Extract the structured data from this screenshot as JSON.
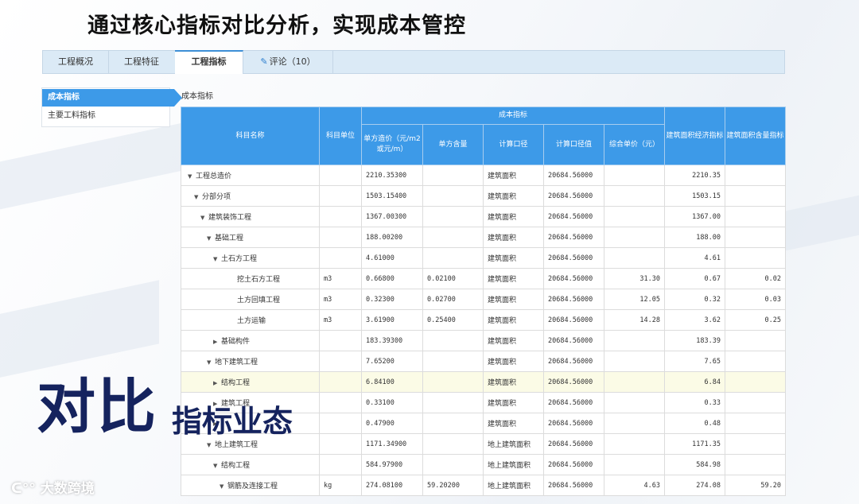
{
  "slide_title": "通过核心指标对比分析，实现成本管控",
  "tabs": [
    {
      "label": "工程概况",
      "active": false
    },
    {
      "label": "工程特征",
      "active": false
    },
    {
      "label": "工程指标",
      "active": true
    },
    {
      "label": "评论（10）",
      "active": false,
      "icon": "pencil-icon"
    }
  ],
  "left_nav": [
    {
      "label": "成本指标",
      "active": true
    },
    {
      "label": "主要工料指标",
      "active": false
    }
  ],
  "section_title": "成本指标",
  "table": {
    "headers": {
      "item_name": "科目名称",
      "unit": "科目单位",
      "group": "成本指标",
      "unit_cost": "单方造价（元/m2或元/m）",
      "unit_qty": "单方含量",
      "calc_basis": "计算口径",
      "calc_value": "计算口径值",
      "comp_price": "综合单价（元）",
      "area_econ": "建筑面积经济指标",
      "area_qty": "建筑面积含量指标"
    },
    "rows": [
      {
        "level": 0,
        "toggle": "expanded",
        "name": "工程总造价",
        "unit": "",
        "unit_cost": "2210.35300",
        "unit_qty": "",
        "basis": "建筑面积",
        "basis_value": "20684.56000",
        "comp_price": "",
        "area_econ": "2210.35",
        "area_qty": "",
        "highlight": false
      },
      {
        "level": 1,
        "toggle": "expanded",
        "name": "分部分项",
        "unit": "",
        "unit_cost": "1503.15400",
        "unit_qty": "",
        "basis": "建筑面积",
        "basis_value": "20684.56000",
        "comp_price": "",
        "area_econ": "1503.15",
        "area_qty": "",
        "highlight": false
      },
      {
        "level": 2,
        "toggle": "expanded",
        "name": "建筑装饰工程",
        "unit": "",
        "unit_cost": "1367.00300",
        "unit_qty": "",
        "basis": "建筑面积",
        "basis_value": "20684.56000",
        "comp_price": "",
        "area_econ": "1367.00",
        "area_qty": "",
        "highlight": false
      },
      {
        "level": 3,
        "toggle": "expanded",
        "name": "基础工程",
        "unit": "",
        "unit_cost": "188.00200",
        "unit_qty": "",
        "basis": "建筑面积",
        "basis_value": "20684.56000",
        "comp_price": "",
        "area_econ": "188.00",
        "area_qty": "",
        "highlight": false
      },
      {
        "level": 4,
        "toggle": "expanded",
        "name": "土石方工程",
        "unit": "",
        "unit_cost": "4.61000",
        "unit_qty": "",
        "basis": "建筑面积",
        "basis_value": "20684.56000",
        "comp_price": "",
        "area_econ": "4.61",
        "area_qty": "",
        "highlight": false
      },
      {
        "level": 5,
        "toggle": "",
        "name": "挖土石方工程",
        "unit": "m3",
        "unit_cost": "0.66800",
        "unit_qty": "0.02100",
        "basis": "建筑面积",
        "basis_value": "20684.56000",
        "comp_price": "31.30",
        "area_econ": "0.67",
        "area_qty": "0.02",
        "highlight": false
      },
      {
        "level": 5,
        "toggle": "",
        "name": "土方回填工程",
        "unit": "m3",
        "unit_cost": "0.32300",
        "unit_qty": "0.02700",
        "basis": "建筑面积",
        "basis_value": "20684.56000",
        "comp_price": "12.05",
        "area_econ": "0.32",
        "area_qty": "0.03",
        "highlight": false
      },
      {
        "level": 5,
        "toggle": "",
        "name": "土方运输",
        "unit": "m3",
        "unit_cost": "3.61900",
        "unit_qty": "0.25400",
        "basis": "建筑面积",
        "basis_value": "20684.56000",
        "comp_price": "14.28",
        "area_econ": "3.62",
        "area_qty": "0.25",
        "highlight": false
      },
      {
        "level": 4,
        "toggle": "collapsed",
        "name": "基础构件",
        "unit": "",
        "unit_cost": "183.39300",
        "unit_qty": "",
        "basis": "建筑面积",
        "basis_value": "20684.56000",
        "comp_price": "",
        "area_econ": "183.39",
        "area_qty": "",
        "highlight": false
      },
      {
        "level": 3,
        "toggle": "expanded",
        "name": "地下建筑工程",
        "unit": "",
        "unit_cost": "7.65200",
        "unit_qty": "",
        "basis": "建筑面积",
        "basis_value": "20684.56000",
        "comp_price": "",
        "area_econ": "7.65",
        "area_qty": "",
        "highlight": false
      },
      {
        "level": 4,
        "toggle": "collapsed",
        "name": "结构工程",
        "unit": "",
        "unit_cost": "6.84100",
        "unit_qty": "",
        "basis": "建筑面积",
        "basis_value": "20684.56000",
        "comp_price": "",
        "area_econ": "6.84",
        "area_qty": "",
        "highlight": true
      },
      {
        "level": 4,
        "toggle": "collapsed",
        "name": "建筑工程",
        "unit": "",
        "unit_cost": "0.33100",
        "unit_qty": "",
        "basis": "建筑面积",
        "basis_value": "20684.56000",
        "comp_price": "",
        "area_econ": "0.33",
        "area_qty": "",
        "highlight": false
      },
      {
        "level": 4,
        "toggle": "collapsed",
        "name": "",
        "unit": "",
        "unit_cost": "0.47900",
        "unit_qty": "",
        "basis": "建筑面积",
        "basis_value": "20684.56000",
        "comp_price": "",
        "area_econ": "0.48",
        "area_qty": "",
        "highlight": false
      },
      {
        "level": 3,
        "toggle": "expanded",
        "name": "地上建筑工程",
        "unit": "",
        "unit_cost": "1171.34900",
        "unit_qty": "",
        "basis": "地上建筑面积",
        "basis_value": "20684.56000",
        "comp_price": "",
        "area_econ": "1171.35",
        "area_qty": "",
        "highlight": false
      },
      {
        "level": 4,
        "toggle": "expanded",
        "name": "结构工程",
        "unit": "",
        "unit_cost": "584.97900",
        "unit_qty": "",
        "basis": "地上建筑面积",
        "basis_value": "20684.56000",
        "comp_price": "",
        "area_econ": "584.98",
        "area_qty": "",
        "highlight": false
      },
      {
        "level": 5,
        "toggle": "expanded",
        "name": "钢筋及连接工程",
        "unit": "kg",
        "unit_cost": "274.08100",
        "unit_qty": "59.20200",
        "basis": "地上建筑面积",
        "basis_value": "20684.56000",
        "comp_price": "4.63",
        "area_econ": "274.08",
        "area_qty": "59.20",
        "highlight": false
      }
    ]
  },
  "overlay": {
    "big": "对比",
    "small": "指标业态"
  },
  "brand": "大数跨境",
  "colors": {
    "header_blue": "#3d9ae8",
    "highlight_row": "#fbfbe6",
    "overlay_navy": "#15235e"
  }
}
